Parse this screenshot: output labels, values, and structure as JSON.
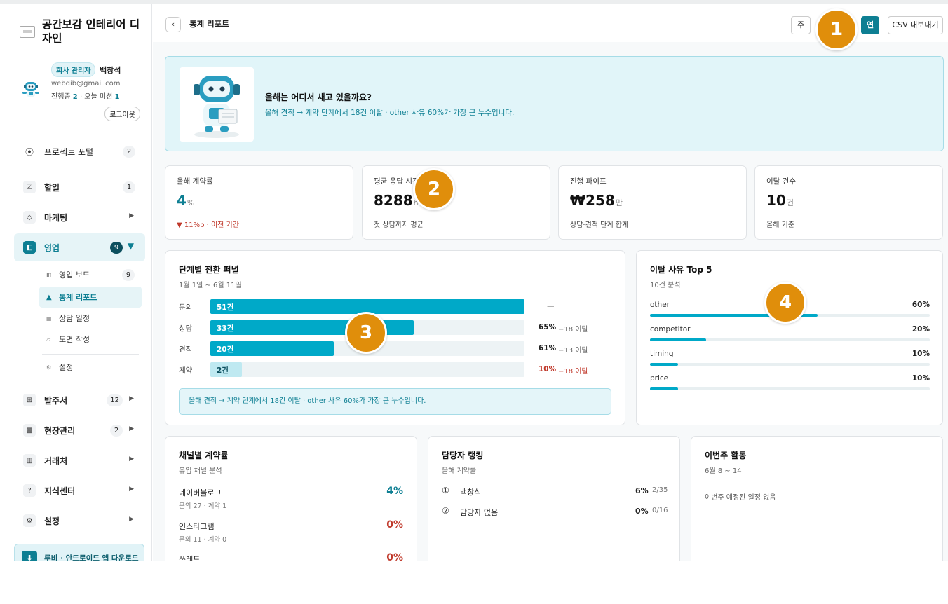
{
  "company": {
    "name": "공간보감 인테리어 디자인"
  },
  "user": {
    "role": "회사 관리자",
    "name": "백창석",
    "email": "webdib@gmail.com",
    "progress_prefix": "진행중",
    "in_progress": "2",
    "progress_mid": "· 오늘 미션",
    "today_missions": "1",
    "logout": "로그아웃"
  },
  "nav": {
    "portal": {
      "label": "프로젝트 포털",
      "count": "2"
    },
    "todo": {
      "label": "할일",
      "count": "1"
    },
    "marketing": {
      "label": "마케팅"
    },
    "sales": {
      "label": "영업",
      "count": "9"
    },
    "sales_sub": [
      {
        "label": "영업 보드",
        "count": "9"
      },
      {
        "label": "통계 리포트"
      },
      {
        "label": "상담 일정"
      },
      {
        "label": "도면 작성"
      },
      {
        "label": "설정"
      }
    ],
    "orders": {
      "label": "발주서",
      "count": "12"
    },
    "site": {
      "label": "현장관리",
      "count": "2"
    },
    "vendors": {
      "label": "거래처"
    },
    "knowledge": {
      "label": "지식센터"
    },
    "settings": {
      "label": "설정"
    },
    "app_download": "루비 · 안드로이드 앱 다운로드"
  },
  "header": {
    "back": "‹",
    "title": "통계 리포트",
    "periods": [
      "주",
      "연"
    ],
    "active_period": "연",
    "export": "CSV 내보내기"
  },
  "banner": {
    "title": "올해는 어디서 새고 있을까요?",
    "desc": "올해 견적 → 계약 단계에서 18건 이탈 · other 사유 60%가 가장 큰 누수입니다."
  },
  "stats": [
    {
      "label": "올해 계약률",
      "value": "4",
      "unit": "%",
      "sub": "▼ 11%p · 이전 기간"
    },
    {
      "label": "평균 응답 시간",
      "value": "8288",
      "unit": "h",
      "sub": "첫 상담까지 평균"
    },
    {
      "label": "진행 파이프",
      "value": "₩258",
      "unit": "만",
      "sub": "상담·견적 단계 합계"
    },
    {
      "label": "이탈 건수",
      "value": "10",
      "unit": "건",
      "sub": "올해 기준"
    }
  ],
  "funnel": {
    "title": "단계별 전환 퍼널",
    "period": "1월 1일 ~ 6월 11일",
    "rows": [
      {
        "stage": "문의",
        "bar_label": "51건",
        "count": 51,
        "pct": "—",
        "drop": ""
      },
      {
        "stage": "상담",
        "bar_label": "33건",
        "count": 33,
        "pct": "65%",
        "drop": "−18 이탈"
      },
      {
        "stage": "견적",
        "bar_label": "20건",
        "count": 20,
        "pct": "61%",
        "drop": "−13 이탈"
      },
      {
        "stage": "계약",
        "bar_label": "2건",
        "count": 2,
        "pct": "10%",
        "drop": "−18 이탈"
      }
    ],
    "note": "올해 견적 → 계약 단계에서 18건 이탈 · other 사유 60%가 가장 큰 누수입니다."
  },
  "reasons": {
    "title": "이탈 사유 Top 5",
    "sub": "10건 분석",
    "rows": [
      {
        "label": "other",
        "pct": "60%",
        "value": 60
      },
      {
        "label": "competitor",
        "pct": "20%",
        "value": 20
      },
      {
        "label": "timing",
        "pct": "10%",
        "value": 10
      },
      {
        "label": "price",
        "pct": "10%",
        "value": 10
      }
    ]
  },
  "channels": {
    "title": "채널별 계약률",
    "sub": "유입 채널 분석",
    "rows": [
      {
        "name": "네이버블로그",
        "sub": "문의 27 · 계약 1",
        "pct": "4%"
      },
      {
        "name": "인스타그램",
        "sub": "문의 11 · 계약 0",
        "pct": "0%"
      },
      {
        "name": "쓰레드",
        "sub": "",
        "pct": "0%"
      }
    ]
  },
  "ranking": {
    "title": "담당자 랭킹",
    "sub": "올해 계약률",
    "rows": [
      {
        "num": "①",
        "name": "백창석",
        "pct": "6%",
        "ratio": "2/35"
      },
      {
        "num": "②",
        "name": "담당자 없음",
        "pct": "0%",
        "ratio": "0/16"
      }
    ]
  },
  "week": {
    "title": "이번주 활동",
    "period": "6월 8 ~ 14",
    "empty": "이번주 예정된 일정 없음"
  },
  "markers": [
    "1",
    "2",
    "3",
    "4"
  ],
  "colors": {
    "accent": "#0e7f93",
    "bar": "#00a9c8",
    "negative": "#c0392b",
    "marker": "#e08e0b"
  }
}
